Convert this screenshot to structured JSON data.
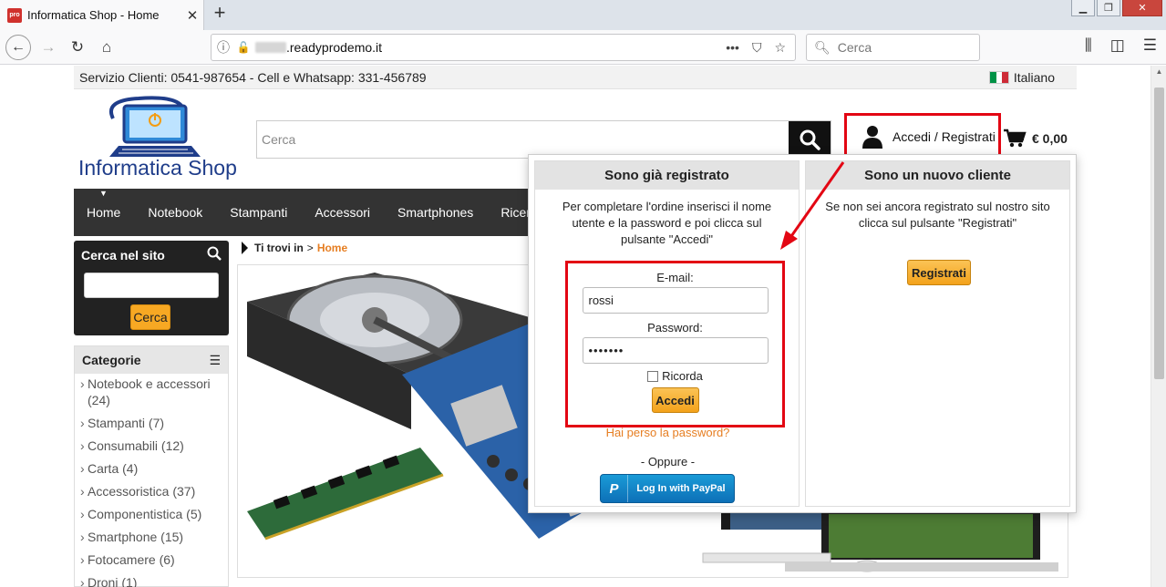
{
  "browser": {
    "tab_title": "Informatica Shop - Home",
    "favicon_text": "pro",
    "url": ".readyprodemo.it",
    "search_placeholder": "Cerca"
  },
  "topstrip": {
    "contact": "Servizio Clienti: 0541-987654 - Cell e Whatsapp: 331-456789",
    "language": "Italiano"
  },
  "header": {
    "logo_text": "Informatica Shop",
    "search_placeholder": "Cerca",
    "account_label": "Accedi / Registrati",
    "cart_total": "€ 0,00"
  },
  "catnav": {
    "items": [
      "Home",
      "Notebook",
      "Stampanti",
      "Accessori",
      "Smartphones",
      "Ricerca"
    ]
  },
  "sidebar": {
    "search_title": "Cerca nel sito",
    "search_button": "Cerca",
    "categories_title": "Categorie",
    "categories": [
      "Notebook e accessori (24)",
      "Stampanti (7)",
      "Consumabili (12)",
      "Carta (4)",
      "Accessoristica (37)",
      "Componentistica (5)",
      "Smartphone (15)",
      "Fotocamere (6)",
      "Droni (1)"
    ]
  },
  "breadcrumb": {
    "prefix": "Ti trovi in",
    "separator": ">",
    "current": "Home"
  },
  "login": {
    "registered_title": "Sono già registrato",
    "registered_text": "Per completare l'ordine inserisci il nome utente e la password e poi clicca sul pulsante \"Accedi\"",
    "email_label": "E-mail:",
    "email_value": "rossi",
    "password_label": "Password:",
    "password_value": "•••••••",
    "remember_label": "Ricorda",
    "submit_label": "Accedi",
    "forgot_label": "Hai perso la password?",
    "or_label": "- Oppure -",
    "paypal_label": "Log In with PayPal",
    "new_title": "Sono un nuovo cliente",
    "new_text": "Se non sei ancora registrato sul nostro sito clicca sul pulsante \"Registrati\"",
    "register_label": "Registrati"
  },
  "colors": {
    "accent_orange": "#f7a823",
    "highlight_red": "#e30613",
    "nav_dark": "#333333",
    "logo_blue": "#1f3d8a"
  }
}
